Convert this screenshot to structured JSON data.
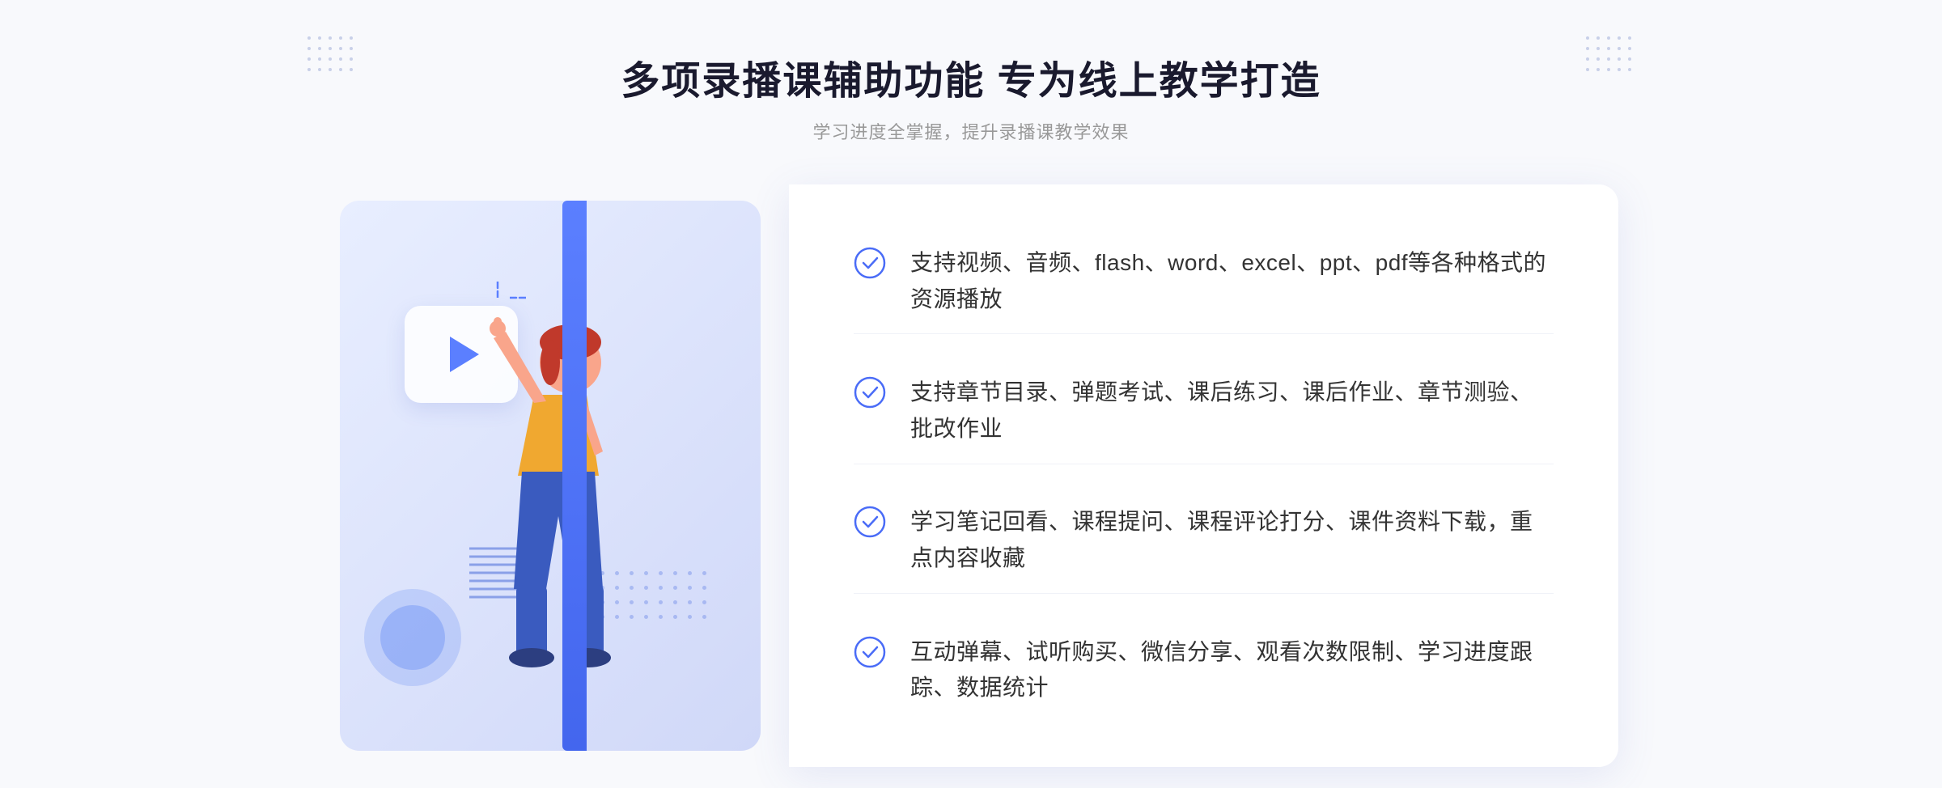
{
  "header": {
    "main_title": "多项录播课辅助功能 专为线上教学打造",
    "sub_title": "学习进度全掌握，提升录播课教学效果"
  },
  "features": [
    {
      "id": 1,
      "text": "支持视频、音频、flash、word、excel、ppt、pdf等各种格式的资源播放"
    },
    {
      "id": 2,
      "text": "支持章节目录、弹题考试、课后练习、课后作业、章节测验、批改作业"
    },
    {
      "id": 3,
      "text": "学习笔记回看、课程提问、课程评论打分、课件资料下载，重点内容收藏"
    },
    {
      "id": 4,
      "text": "互动弹幕、试听购买、微信分享、观看次数限制、学习进度跟踪、数据统计"
    }
  ],
  "navigation": {
    "left_chevron": "«"
  },
  "colors": {
    "accent_blue": "#4a6cf7",
    "light_blue": "#e8eeff",
    "text_dark": "#1a1a2e",
    "text_gray": "#999999",
    "text_normal": "#333333"
  }
}
